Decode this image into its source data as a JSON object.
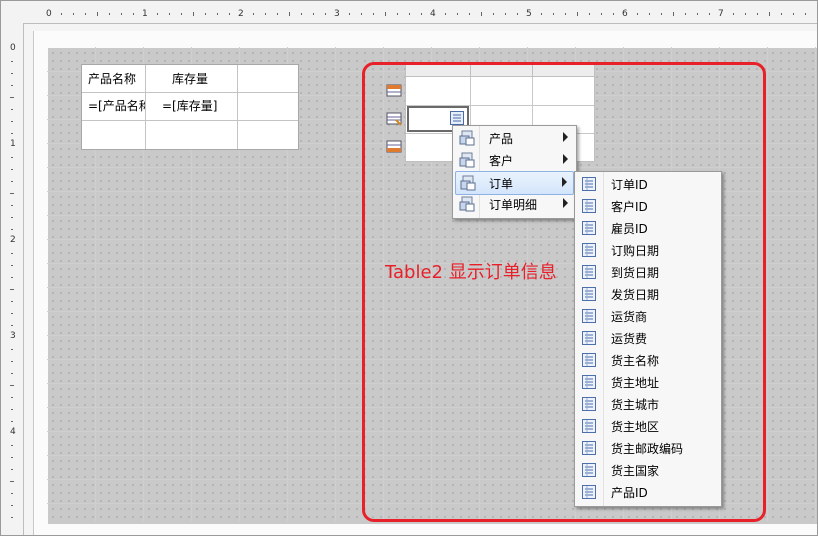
{
  "ruler": {
    "horizontal_numbers": [
      "0",
      "1",
      "2",
      "3",
      "4",
      "5",
      "6",
      "7"
    ],
    "vertical_numbers": [
      "0",
      "1",
      "2",
      "3",
      "4"
    ]
  },
  "table1": {
    "headers": [
      "产品名称",
      "库存量",
      ""
    ],
    "row1": [
      "=[产品名称]",
      "=[库存量]",
      ""
    ]
  },
  "context_menu": {
    "items": [
      {
        "label": "产品",
        "icon": "data-table-icon",
        "has_submenu": true
      },
      {
        "label": "客户",
        "icon": "data-table-icon",
        "has_submenu": true
      },
      {
        "label": "订单",
        "icon": "data-table-icon",
        "has_submenu": true,
        "highlighted": true
      },
      {
        "label": "订单明细",
        "icon": "data-table-icon",
        "has_submenu": true
      }
    ]
  },
  "submenu": {
    "items": [
      "订单ID",
      "客户ID",
      "雇员ID",
      "订购日期",
      "到货日期",
      "发货日期",
      "运货商",
      "运货费",
      "货主名称",
      "货主地址",
      "货主城市",
      "货主地区",
      "货主邮政编码",
      "货主国家",
      "产品ID"
    ]
  },
  "annotation": {
    "text": "Table2 显示订单信息",
    "color": "#e8202a"
  },
  "colors": {
    "highlight": "#d3e5fb",
    "menu_bg": "#f7f7f7"
  }
}
